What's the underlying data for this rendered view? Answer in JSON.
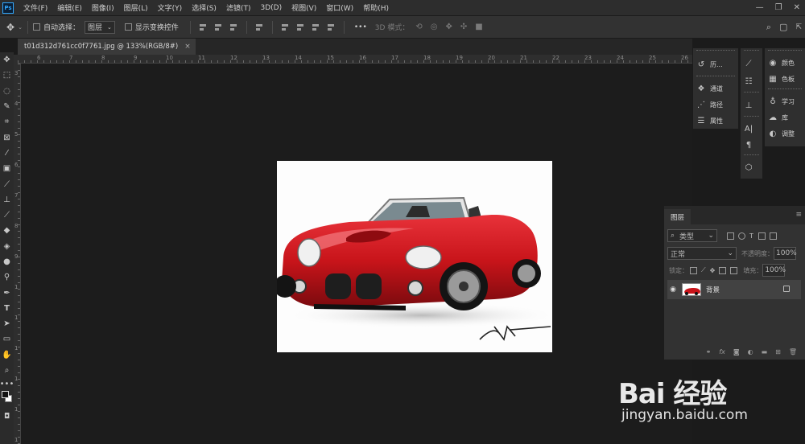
{
  "app": {
    "logo": "Ps"
  },
  "menu": [
    "文件(F)",
    "编辑(E)",
    "图像(I)",
    "图层(L)",
    "文字(Y)",
    "选择(S)",
    "滤镜(T)",
    "3D(D)",
    "视图(V)",
    "窗口(W)",
    "帮助(H)"
  ],
  "options": {
    "auto_select_label": "自动选择：",
    "auto_select_value": "图层",
    "show_transform_label": "显示变换控件",
    "more": "•••",
    "mode_3d_label": "3D 模式："
  },
  "document": {
    "tab_title": "t01d312d761cc0f7761.jpg @ 133%(RGB/8#)",
    "close": "×"
  },
  "ruler": {
    "h_ticks": [
      "6",
      "7",
      "8",
      "9",
      "10",
      "11",
      "12",
      "13",
      "14",
      "15",
      "16",
      "17",
      "18",
      "19",
      "20",
      "21",
      "22",
      "23",
      "24",
      "25",
      "26"
    ],
    "v_ticks": [
      "3",
      "4",
      "5",
      "6",
      "7",
      "8",
      "9",
      "1",
      "1",
      "1",
      "1",
      "1",
      "1"
    ]
  },
  "panels": {
    "col1": [
      {
        "icon": "history-icon",
        "label": "历..."
      },
      {
        "icon": "channels-icon",
        "label": "通道"
      },
      {
        "icon": "paths-icon",
        "label": "路径"
      },
      {
        "icon": "properties-icon",
        "label": "属性"
      }
    ],
    "col3": [
      {
        "icon": "color-icon",
        "label": "颜色"
      },
      {
        "icon": "swatches-icon",
        "label": "色板"
      },
      {
        "icon": "learn-icon",
        "label": "学习"
      },
      {
        "icon": "libraries-icon",
        "label": "库"
      },
      {
        "icon": "adjustments-icon",
        "label": "调整"
      }
    ]
  },
  "layers": {
    "tab": "图层",
    "filter_label": "类型",
    "blend_mode": "正常",
    "opacity_label": "不透明度：",
    "opacity_value": "100%",
    "lock_label": "锁定：",
    "fill_label": "填充：",
    "fill_value": "100%",
    "items": [
      {
        "name": "背景",
        "visible": true,
        "locked": true
      }
    ],
    "footer_fx": "fx"
  },
  "watermark": {
    "logo": "Bai 经验",
    "url": "jingyan.baidu.com"
  },
  "colors": {
    "accent": "#31a8ff",
    "car_red": "#c8141a",
    "bg": "#1b1b1b"
  }
}
